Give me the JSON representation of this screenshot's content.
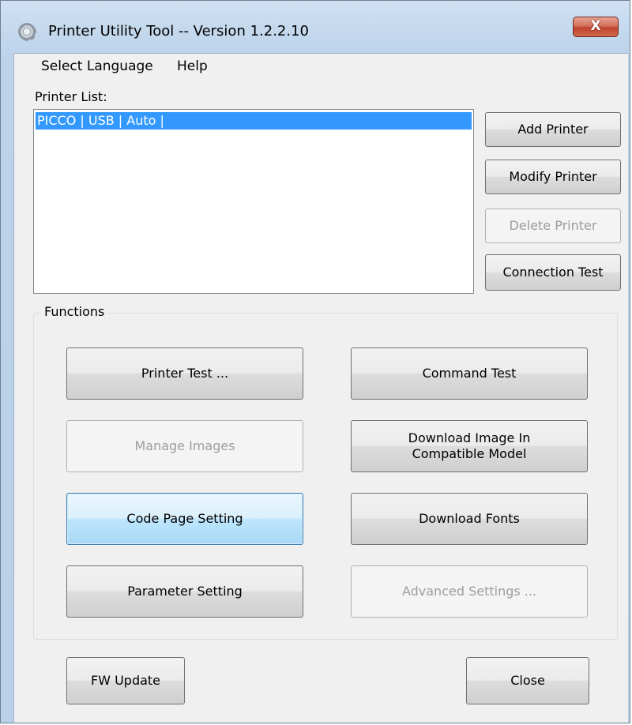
{
  "window": {
    "title": "Printer Utility Tool -- Version 1.2.2.10",
    "close_label": "X",
    "app_icon": "gear-icon"
  },
  "menu": {
    "items": [
      "Select Language",
      "Help"
    ]
  },
  "printer_list": {
    "label": "Printer List:",
    "items": [
      "PICCO | USB | Auto |"
    ],
    "selected_index": 0
  },
  "side_buttons": {
    "add": "Add Printer",
    "modify": "Modify Printer",
    "delete": "Delete Printer",
    "connection_test": "Connection Test"
  },
  "functions": {
    "title": "Functions",
    "printer_test": "Printer Test ...",
    "command_test": "Command Test",
    "manage_images": "Manage Images",
    "download_image": "Download Image In\nCompatible Model",
    "code_page": "Code Page Setting",
    "download_fonts": "Download Fonts",
    "parameter_setting": "Parameter Setting",
    "advanced_settings": "Advanced Settings ..."
  },
  "bottom": {
    "fw_update": "FW Update",
    "close": "Close"
  },
  "colors": {
    "selection": "#3399ff",
    "close_button": "#c0432c",
    "focus_border": "#3c7fb1"
  }
}
